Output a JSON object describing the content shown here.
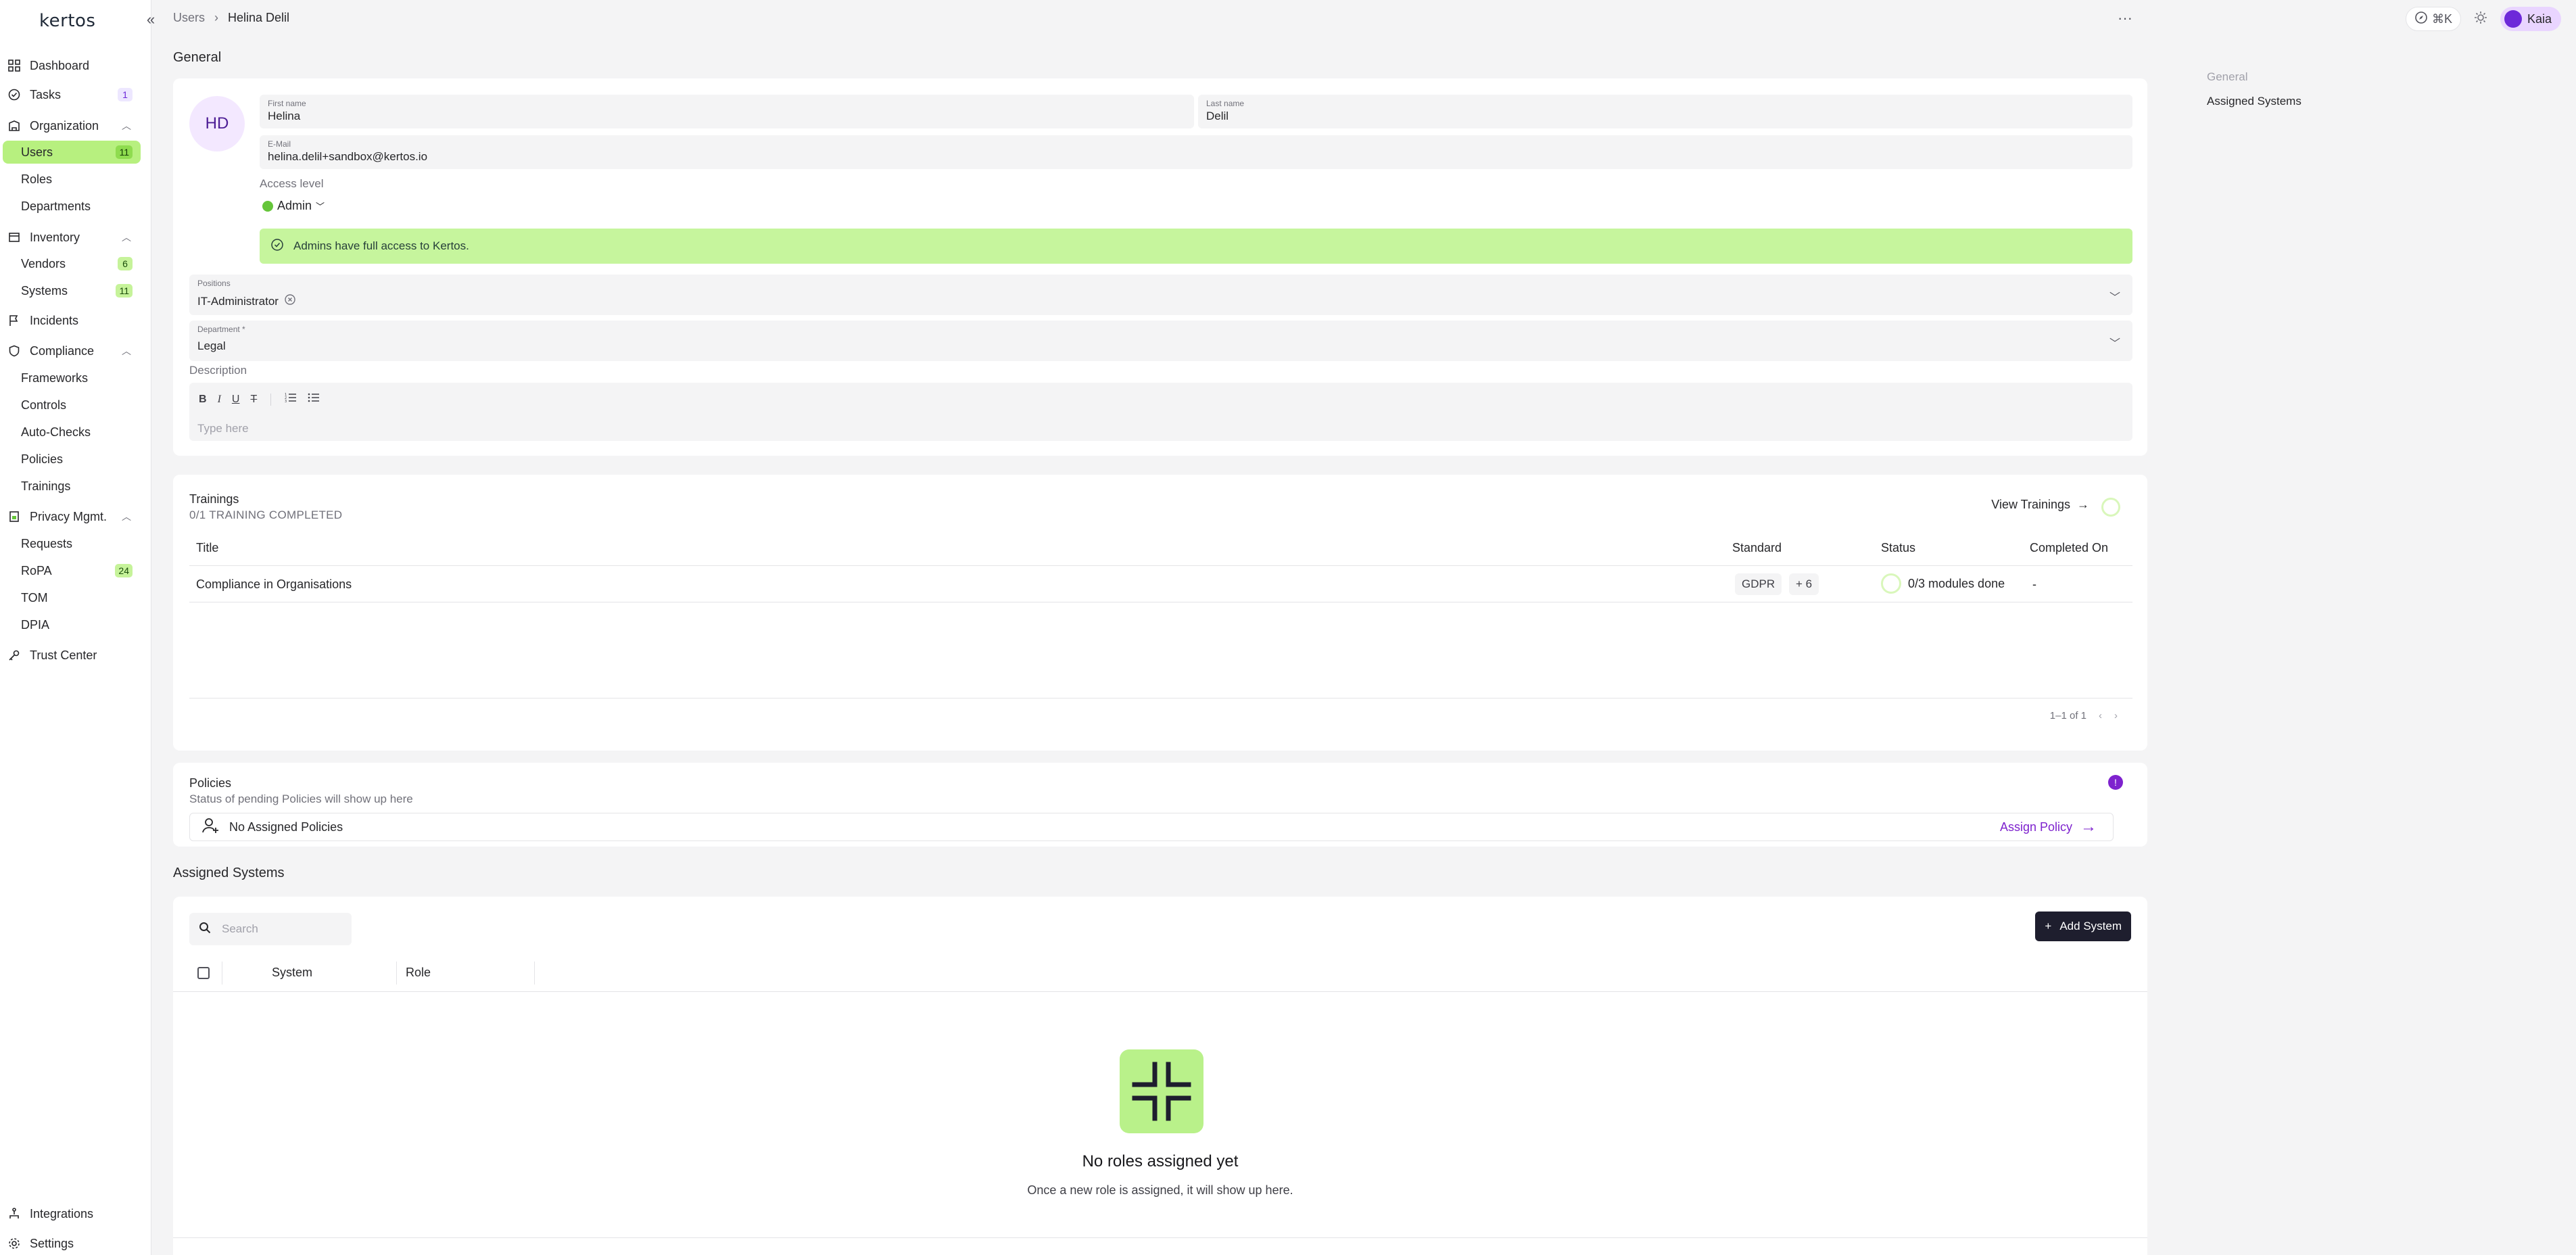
{
  "sidebar": {
    "logo": "kertos",
    "items": [
      {
        "label": "Dashboard",
        "icon": "grid-icon"
      },
      {
        "label": "Tasks",
        "icon": "check-circle-icon",
        "badge": "1"
      },
      {
        "label": "Organization",
        "icon": "building-icon"
      },
      {
        "label": "Users",
        "badge": "11"
      },
      {
        "label": "Roles"
      },
      {
        "label": "Departments"
      },
      {
        "label": "Inventory",
        "icon": "box-icon"
      },
      {
        "label": "Vendors",
        "badge": "6"
      },
      {
        "label": "Systems",
        "badge": "11"
      },
      {
        "label": "Incidents",
        "icon": "flag-icon"
      },
      {
        "label": "Compliance",
        "icon": "shield-icon"
      },
      {
        "label": "Frameworks"
      },
      {
        "label": "Controls"
      },
      {
        "label": "Auto-Checks"
      },
      {
        "label": "Policies"
      },
      {
        "label": "Trainings"
      },
      {
        "label": "Privacy Mgmt.",
        "icon": "lock-doc-icon"
      },
      {
        "label": "Requests"
      },
      {
        "label": "RoPA",
        "badge": "24"
      },
      {
        "label": "TOM"
      },
      {
        "label": "DPIA"
      },
      {
        "label": "Trust Center",
        "icon": "key-icon"
      },
      {
        "label": "Integrations",
        "icon": "network-icon"
      },
      {
        "label": "Settings",
        "icon": "gear-icon"
      }
    ]
  },
  "breadcrumb": {
    "parent": "Users",
    "current": "Helina Delil"
  },
  "topbar": {
    "shortcut": "⌘K",
    "user": "Kaia"
  },
  "general": {
    "title": "General",
    "initials": "HD",
    "first_name_label": "First name",
    "first_name": "Helina",
    "last_name_label": "Last name",
    "last_name": "Delil",
    "email_label": "E-Mail",
    "email": "helina.delil+sandbox@kertos.io",
    "access_label": "Access level",
    "access_value": "Admin",
    "alert": "Admins have full access to Kertos.",
    "positions_label": "Positions",
    "positions_value": "IT-Administrator",
    "department_label": "Department *",
    "department_value": "Legal",
    "description_label": "Description",
    "description_placeholder": "Type here"
  },
  "trainings": {
    "title": "Trainings",
    "subtitle": "0/1 TRAINING COMPLETED",
    "view_label": "View Trainings",
    "columns": [
      "Title",
      "Standard",
      "Status",
      "Completed On"
    ],
    "rows": [
      {
        "title": "Compliance in Organisations",
        "standard": "GDPR",
        "extra": "+ 6",
        "status": "0/3 modules done",
        "completed": "-"
      }
    ],
    "pager": "1–1 of 1"
  },
  "policies": {
    "title": "Policies",
    "subtitle": "Status of pending Policies will show up here",
    "badge": "!",
    "empty": "No Assigned Policies",
    "assign_label": "Assign Policy"
  },
  "systems": {
    "title": "Assigned Systems",
    "search_placeholder": "Search",
    "add_label": "Add System",
    "columns": [
      "System",
      "Role"
    ],
    "empty_title": "No roles assigned yet",
    "empty_sub": "Once a new role is assigned, it will show up here."
  },
  "toc": [
    "General",
    "Assigned Systems"
  ]
}
